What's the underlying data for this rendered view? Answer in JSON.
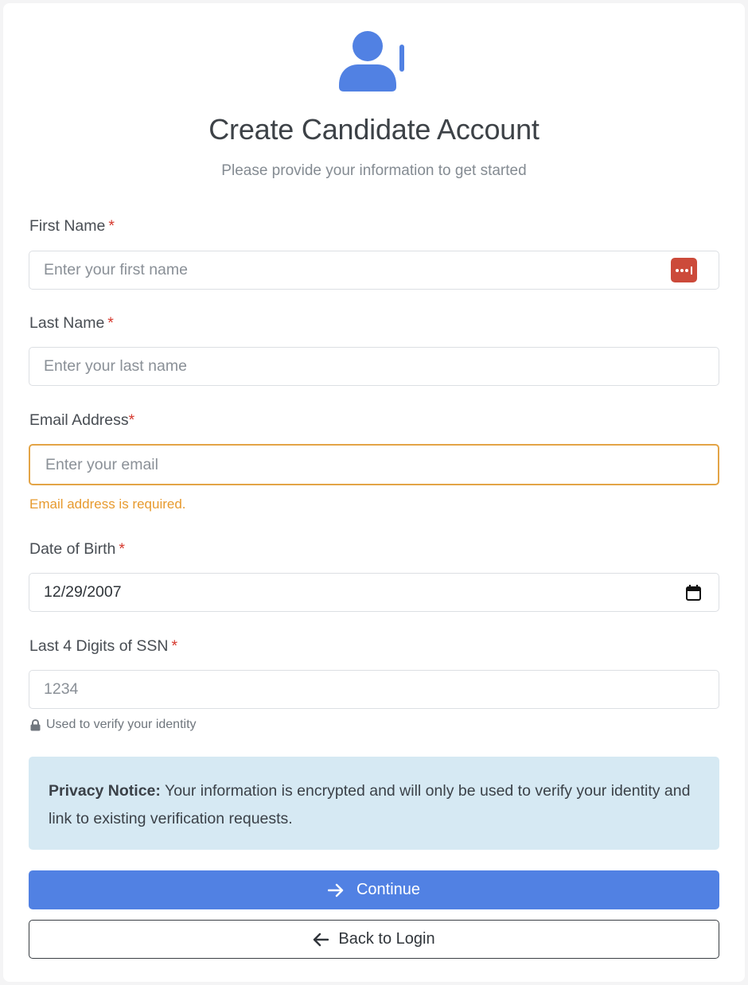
{
  "header": {
    "title": "Create Candidate Account",
    "subtitle": "Please provide your information to get started"
  },
  "form": {
    "first_name": {
      "label": "First Name",
      "required_mark": "*",
      "placeholder": "Enter your first name",
      "value": ""
    },
    "last_name": {
      "label": "Last Name",
      "required_mark": "*",
      "placeholder": "Enter your last name",
      "value": ""
    },
    "email": {
      "label": "Email Address",
      "required_mark": "*",
      "placeholder": "Enter your email",
      "value": "",
      "error": "Email address is required."
    },
    "dob": {
      "label": "Date of Birth",
      "required_mark": "*",
      "value": "12/29/2007"
    },
    "ssn": {
      "label": "Last 4 Digits of SSN",
      "required_mark": "*",
      "placeholder": "1234",
      "value": "",
      "hint": "Used to verify your identity"
    }
  },
  "notice": {
    "title": "Privacy Notice:",
    "text": " Your information is encrypted and will only be used to verify your identity and link to existing verification requests."
  },
  "buttons": {
    "continue": "Continue",
    "back": "Back to Login"
  },
  "icons": {
    "header": "user-plus-icon",
    "password_manager": "password-manager-icon",
    "calendar": "calendar-icon",
    "lock": "lock-icon",
    "arrow_right": "arrow-right-icon",
    "arrow_left": "arrow-left-icon"
  },
  "colors": {
    "accent": "#5181e3",
    "required": "#d63a2f",
    "warning": "#e79a2e",
    "notice_bg": "#d6e9f3",
    "password_badge": "#cc4a3a"
  }
}
